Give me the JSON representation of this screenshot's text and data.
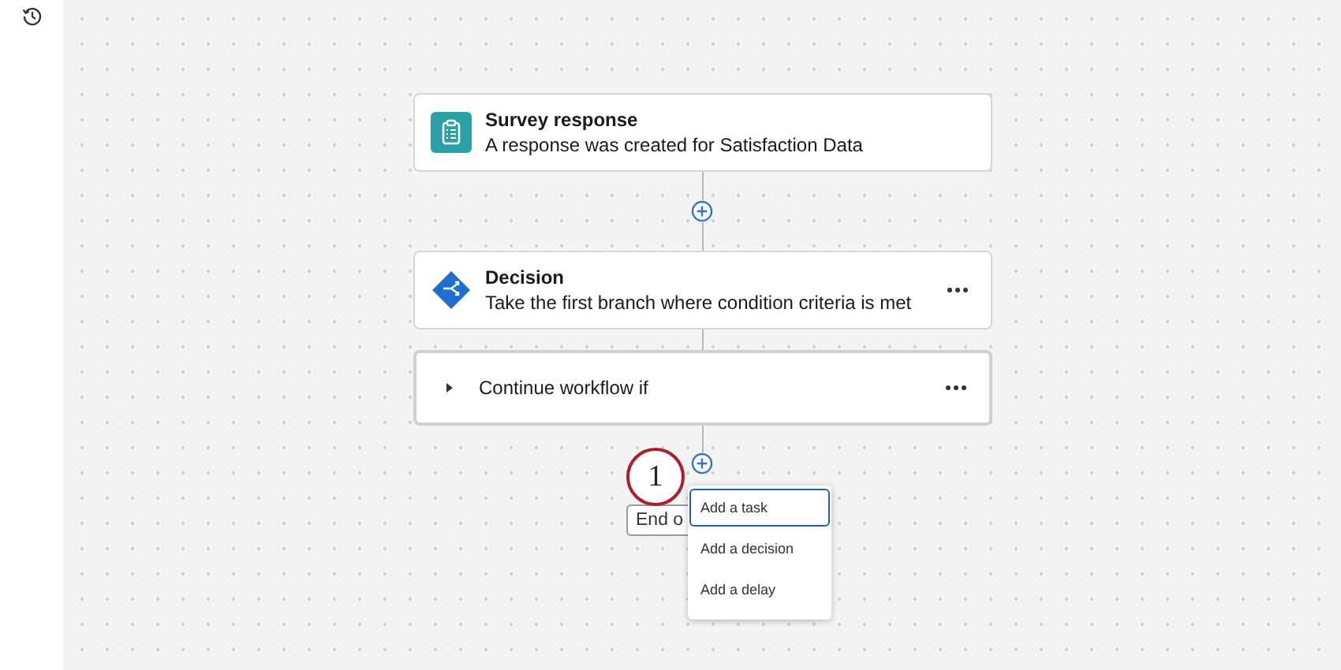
{
  "nodes": [
    {
      "kind": "trigger",
      "title": "Survey response",
      "description": "A response was created for Satisfaction Data",
      "has_menu": false
    },
    {
      "kind": "decision",
      "title": "Decision",
      "description": "Take the first branch where condition criteria is met",
      "has_menu": true
    },
    {
      "kind": "condition",
      "label": "Continue workflow if",
      "expanded": false,
      "has_menu": true
    }
  ],
  "end_button": {
    "label": "End o"
  },
  "callout": {
    "label": "1"
  },
  "add_menu": {
    "items": [
      {
        "label": "Add a task",
        "selected": true
      },
      {
        "label": "Add a decision",
        "selected": false
      },
      {
        "label": "Add a delay",
        "selected": false
      }
    ]
  }
}
